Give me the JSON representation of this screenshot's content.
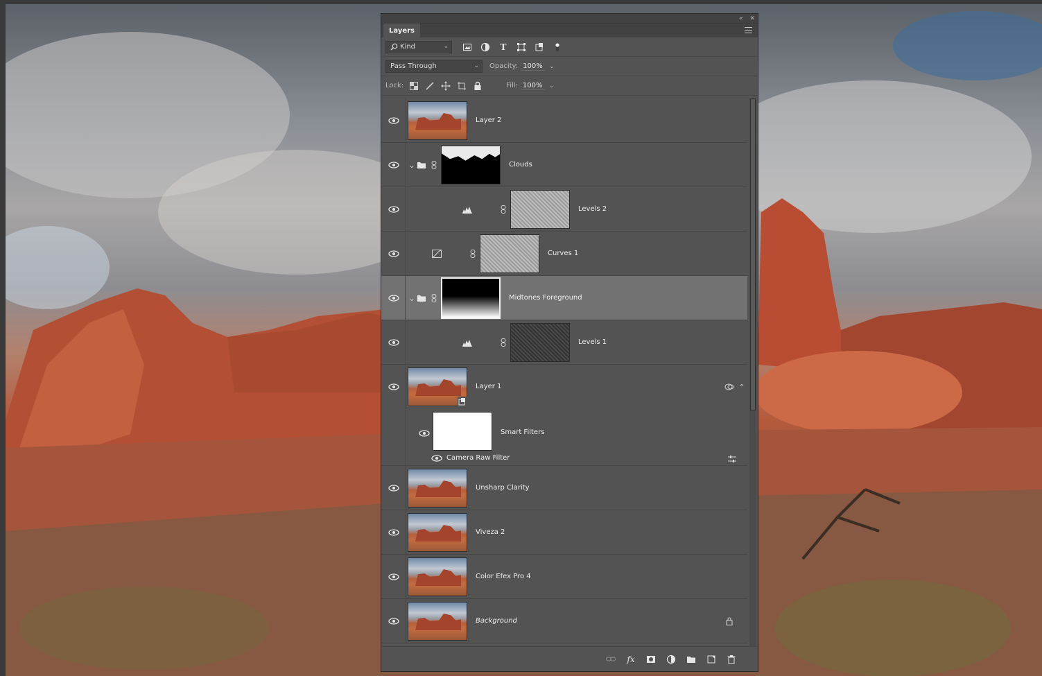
{
  "panel": {
    "tab_label": "Layers",
    "window_controls": {
      "collapse": "«",
      "close": "✕"
    }
  },
  "filter": {
    "kind_label": "Kind",
    "icons": [
      "image-filter-icon",
      "adjustment-filter-icon",
      "type-filter-icon",
      "shape-filter-icon",
      "smart-object-filter-icon",
      "filter-toggle-icon"
    ]
  },
  "blend": {
    "mode": "Pass Through",
    "opacity_label": "Opacity:",
    "opacity_value": "100%"
  },
  "lock": {
    "label": "Lock:",
    "fill_label": "Fill:",
    "fill_value": "100%"
  },
  "layers": [
    {
      "name": "Layer 2",
      "type": "pixel",
      "thumb": "photo",
      "visible": true
    },
    {
      "name": "Clouds",
      "type": "group",
      "thumb": "cloud-mask",
      "expanded": true,
      "visible": true
    },
    {
      "name": "Levels 2",
      "type": "adjustment-levels",
      "thumb": "grain-light",
      "visible": true
    },
    {
      "name": "Curves 1",
      "type": "adjustment-curves",
      "thumb": "grain-light",
      "visible": true
    },
    {
      "name": "Midtones Foreground",
      "type": "group",
      "thumb": "gradient-mask",
      "expanded": true,
      "selected": true,
      "visible": true
    },
    {
      "name": "Levels 1",
      "type": "adjustment-levels",
      "thumb": "grain-dark",
      "visible": true
    },
    {
      "name": "Layer 1",
      "type": "smart-object",
      "thumb": "photo",
      "visible": true
    },
    {
      "name": "Smart Filters",
      "type": "smart-filters",
      "thumb": "white",
      "visible": true
    },
    {
      "name": "Camera Raw Filter",
      "type": "filter",
      "visible": true
    },
    {
      "name": "Unsharp Clarity",
      "type": "pixel",
      "thumb": "photo",
      "visible": true
    },
    {
      "name": "Viveza 2",
      "type": "pixel",
      "thumb": "photo",
      "visible": true
    },
    {
      "name": "Color Efex Pro 4",
      "type": "pixel",
      "thumb": "photo",
      "visible": true
    },
    {
      "name": "Background",
      "type": "background",
      "thumb": "photo",
      "locked": true,
      "visible": true
    }
  ],
  "bottom_bar": [
    "link-layers-icon",
    "fx-icon",
    "add-mask-icon",
    "new-adjustment-icon",
    "new-group-icon",
    "new-layer-icon",
    "delete-layer-icon"
  ],
  "bottom_bar_fx": "fx"
}
